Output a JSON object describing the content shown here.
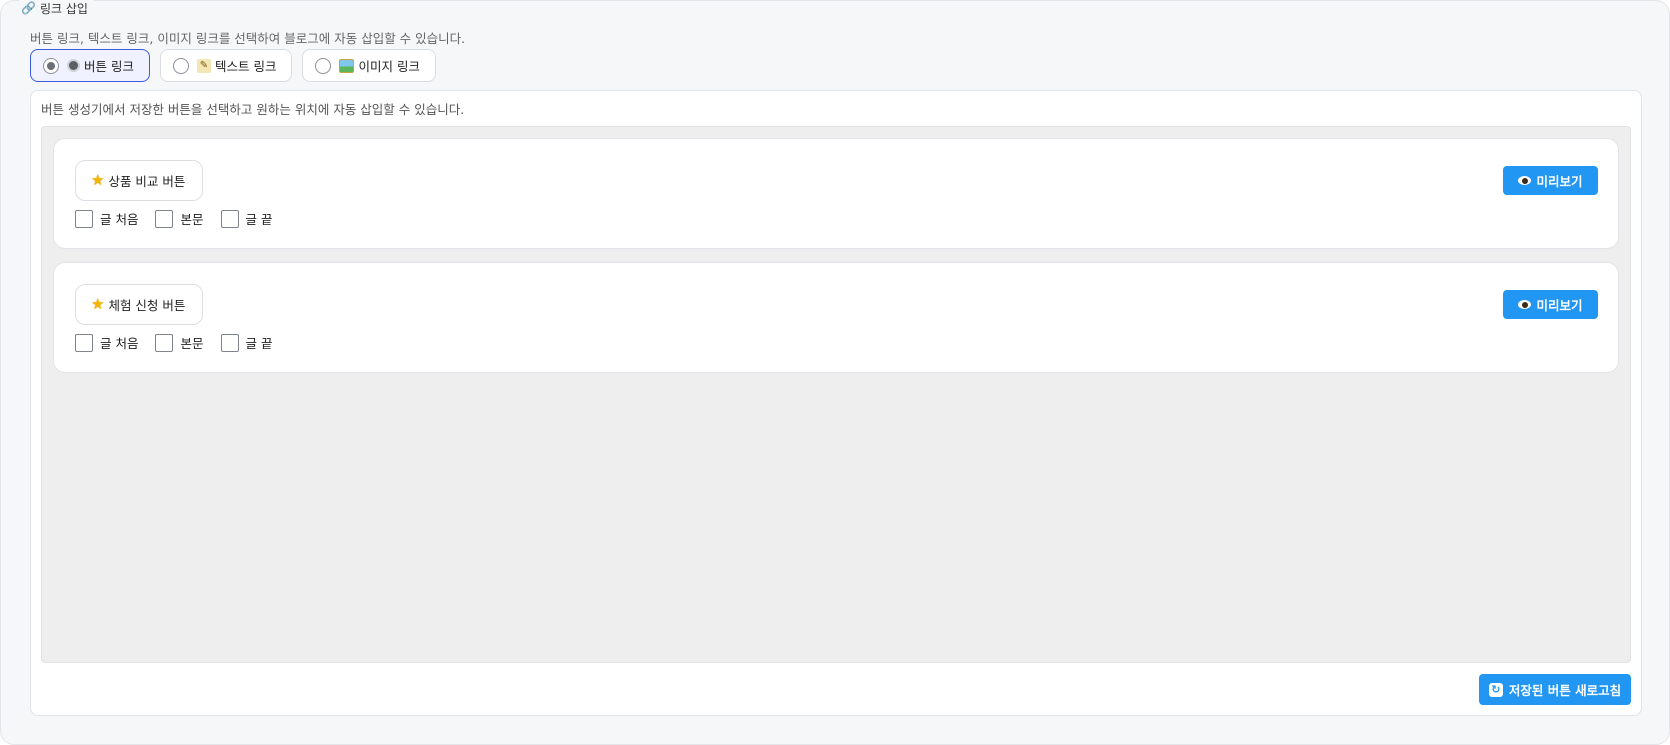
{
  "section": {
    "title": "링크 삽입",
    "description": "버튼 링크, 텍스트 링크, 이미지 링크를 선택하여 블로그에 자동 삽입할 수 있습니다."
  },
  "link_types": [
    {
      "label": "버튼 링크",
      "icon": "button-icon",
      "selected": true
    },
    {
      "label": "텍스트 링크",
      "icon": "memo-icon",
      "selected": false
    },
    {
      "label": "이미지 링크",
      "icon": "picture-icon",
      "selected": false
    }
  ],
  "panel": {
    "description": "버튼 생성기에서 저장한 버튼을 선택하고 원하는 위치에 자동 삽입할 수 있습니다."
  },
  "buttons": [
    {
      "name": "상품 비교 버튼",
      "icon": "star-icon",
      "positions": [
        {
          "label": "글 처음",
          "checked": false
        },
        {
          "label": "본문",
          "checked": false
        },
        {
          "label": "글 끝",
          "checked": false
        }
      ],
      "preview_label": "미리보기"
    },
    {
      "name": "체험 신청 버튼",
      "icon": "star-icon",
      "positions": [
        {
          "label": "글 처음",
          "checked": false
        },
        {
          "label": "본문",
          "checked": false
        },
        {
          "label": "글 끝",
          "checked": false
        }
      ],
      "preview_label": "미리보기"
    }
  ],
  "refresh_label": "저장된 버튼 새로고침",
  "colors": {
    "primary": "#2196f3",
    "selected_border": "#3b5bdb",
    "list_background": "#eeeeee"
  }
}
